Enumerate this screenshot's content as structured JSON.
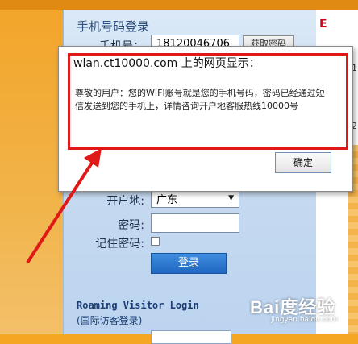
{
  "login": {
    "title": "手机号码登录",
    "phone_label": "手机号：",
    "phone_value": "18120046706",
    "get_code_label": "获取密码",
    "carrier_label": "开户地:",
    "carrier_value": "广东",
    "password_label": "密码:",
    "remember_label": "记住密码:",
    "login_button": "登录",
    "roaming_title": "Roaming Visitor Login",
    "roaming_subtitle": "(国际访客登录)"
  },
  "dialog": {
    "title": "wlan.ct10000.com 上的网页显示：",
    "message": "尊敬的用户：您的WIFI账号就是您的手机号码，密码已经通过短信发送到您的手机上，详情咨询开户地客服热线10000号",
    "ok_label": "确定"
  },
  "right_panel": {
    "red_text": "E",
    "num1": "1",
    "num2": "2"
  },
  "annotation": {
    "box_color": "#e01818",
    "arrow_color": "#e01818"
  },
  "watermark": {
    "text": "Bai度经验",
    "url": "jingyan.baidu.com"
  }
}
